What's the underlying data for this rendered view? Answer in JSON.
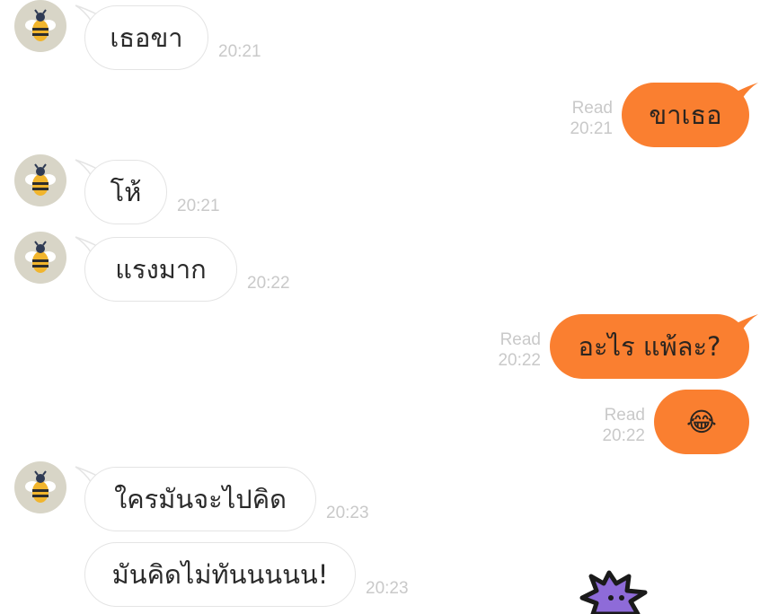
{
  "colors": {
    "outgoing_bubble": "#fa7f30",
    "incoming_bubble": "#ffffff",
    "meta_text": "#c9c9c9",
    "avatar_bg": "#d8d5c7"
  },
  "contact": {
    "avatar_icon": "bee-icon"
  },
  "messages": [
    {
      "dir": "in",
      "text": "เธอขา",
      "time": "20:21"
    },
    {
      "dir": "out",
      "text": "ขาเธอ",
      "read": "Read",
      "time": "20:21"
    },
    {
      "dir": "in",
      "text": "โห้",
      "time": "20:21"
    },
    {
      "dir": "in",
      "text": "แรงมาก",
      "time": "20:22"
    },
    {
      "dir": "out",
      "text": "อะไร แพ้ละ?",
      "read": "Read",
      "time": "20:22"
    },
    {
      "dir": "out",
      "text": "😂",
      "read": "Read",
      "time": "20:22"
    },
    {
      "dir": "in",
      "text": "ใครมันจะไปคิด",
      "time": "20:23"
    },
    {
      "dir": "in",
      "text": "มันคิดไม่ทันนนนน!",
      "time": "20:23"
    }
  ],
  "sticker": {
    "icon": "purple-star-sticker-icon"
  }
}
